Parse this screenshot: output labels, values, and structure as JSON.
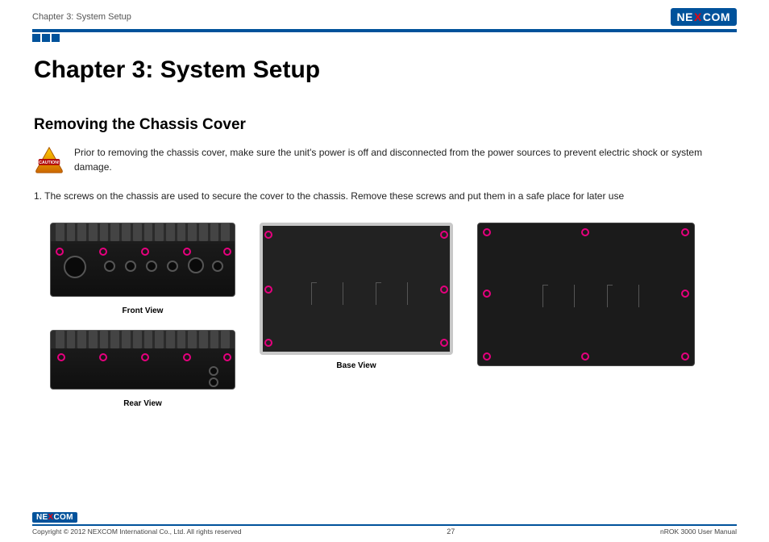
{
  "header": {
    "breadcrumb": "Chapter 3: System Setup",
    "logo_parts": {
      "pre": "NE",
      "x": "X",
      "post": "COM"
    }
  },
  "content": {
    "chapter_title": "Chapter 3: System Setup",
    "section_title": "Removing the Chassis Cover",
    "caution_text": "Prior to removing the chassis cover, make sure the unit's power is off and disconnected from the power sources to prevent electric shock or system damage.",
    "step1": "1. The screws on the chassis are used to secure the cover to the chassis. Remove these screws and put them in a safe place for later use",
    "captions": {
      "front": "Front View",
      "rear": "Rear View",
      "base": "Base View"
    }
  },
  "footer": {
    "copyright": "Copyright © 2012 NEXCOM International Co., Ltd. All rights reserved",
    "page": "27",
    "manual": "nROK 3000 User Manual"
  }
}
